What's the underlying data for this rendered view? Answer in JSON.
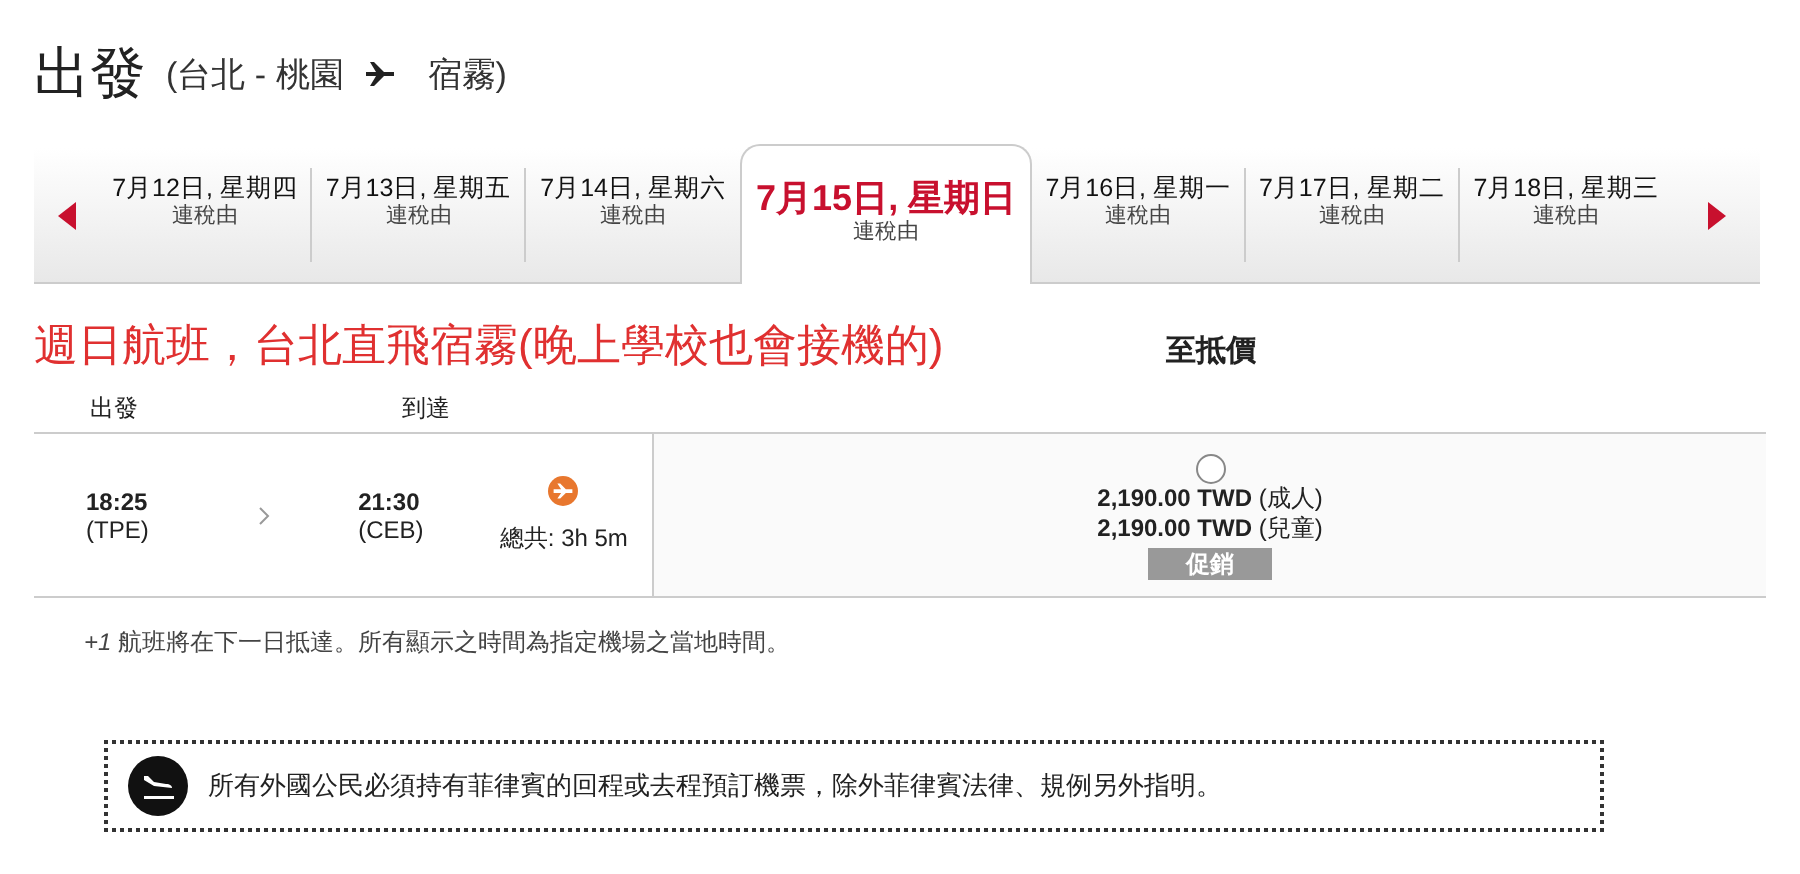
{
  "header": {
    "title": "出發",
    "route_from": "(台北 - 桃園",
    "route_to": "宿霧)"
  },
  "date_tabs": [
    {
      "date": "7月12日, 星期四",
      "note": "連稅由",
      "selected": false
    },
    {
      "date": "7月13日, 星期五",
      "note": "連稅由",
      "selected": false
    },
    {
      "date": "7月14日, 星期六",
      "note": "連稅由",
      "selected": false
    },
    {
      "date": "7月15日, 星期日",
      "note": "連稅由",
      "selected": true
    },
    {
      "date": "7月16日, 星期一",
      "note": "連稅由",
      "selected": false
    },
    {
      "date": "7月17日, 星期二",
      "note": "連稅由",
      "selected": false
    },
    {
      "date": "7月18日, 星期三",
      "note": "連稅由",
      "selected": false
    }
  ],
  "annotation": "週日航班，台北直飛宿霧(晚上學校也會接機的)",
  "table": {
    "columns": [
      "出發",
      "到達"
    ],
    "price_heading": "至抵價",
    "rows": [
      {
        "depart_time": "18:25",
        "depart_code": "(TPE)",
        "arrive_time": "21:30",
        "arrive_code": "(CEB)",
        "duration": "總共: 3h 5m",
        "selected": false,
        "prices": [
          {
            "amount": "2,190.00 TWD",
            "label": "(成人)"
          },
          {
            "amount": "2,190.00 TWD",
            "label": "(兒童)"
          }
        ],
        "badge": "促銷"
      }
    ]
  },
  "footnote": {
    "mark": "+1",
    "text": "航班將在下一日抵達。所有顯示之時間為指定機場之當地時間。"
  },
  "notice": "所有外國公民必須持有菲律賓的回程或去程預訂機票，除外菲律賓法律、規例另外指明。"
}
